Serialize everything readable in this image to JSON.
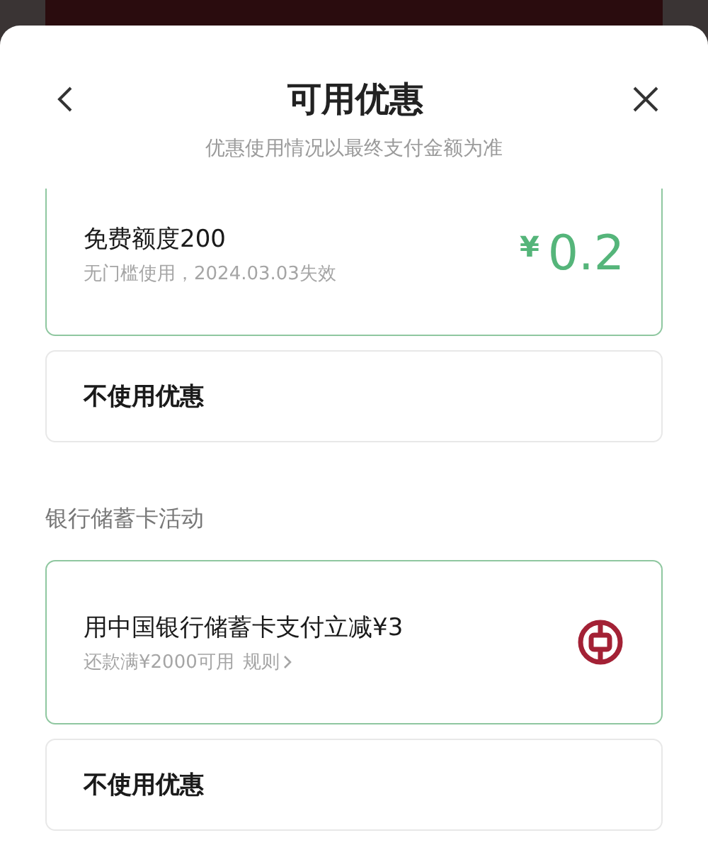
{
  "sheet": {
    "title": "可用优惠",
    "subtitle": "优惠使用情况以最终支付金额为准"
  },
  "sections": [
    {
      "options": [
        {
          "kind": "offer",
          "selected": true,
          "title": "免费额度200",
          "detail": "无门槛使用，2024.03.03失效",
          "currency": "¥",
          "amount": "0.2"
        },
        {
          "kind": "none",
          "selected": false,
          "title": "不使用优惠"
        }
      ]
    },
    {
      "label": "银行储蓄卡活动",
      "options": [
        {
          "kind": "bank",
          "selected": true,
          "title": "用中国银行储蓄卡支付立减¥3",
          "detail": "还款满¥2000可用",
          "rule_link": "规则"
        },
        {
          "kind": "none",
          "selected": false,
          "title": "不使用优惠"
        }
      ]
    }
  ]
}
